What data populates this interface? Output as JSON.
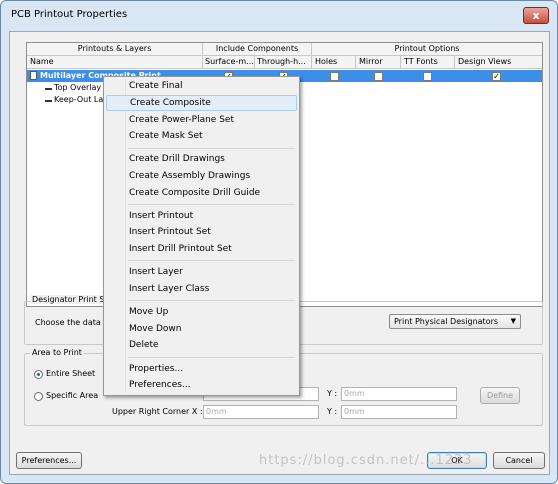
{
  "window": {
    "title": "PCB Printout Properties",
    "close_label": "x"
  },
  "grid": {
    "group_headers": [
      "Printouts & Layers",
      "Include Components",
      "Printout Options"
    ],
    "columns": [
      "Name",
      "Surface-m...",
      "Through-h...",
      "Holes",
      "Mirror",
      "TT Fonts",
      "Design Views"
    ],
    "rows": [
      {
        "name": "Multilayer Composite Print",
        "checks": [
          true,
          true,
          false,
          false,
          false,
          true
        ]
      },
      {
        "name": "Top Overlay"
      },
      {
        "name": "Keep-Out Layer"
      }
    ]
  },
  "designator": {
    "legend": "Designator Print Settings",
    "prompt": "Choose the data to print in component designators",
    "select_value": "Print Physical Designators"
  },
  "area": {
    "legend": "Area to Print",
    "entire_sheet": "Entire Sheet",
    "specific_area": "Specific Area",
    "ll_x_value": "0mm",
    "ll_y_value": "0mm",
    "upper_right_label": "Upper Right Corner X :",
    "y_label": "Y :",
    "ur_x_value": "0mm",
    "ur_y_value": "0mm",
    "define_label": "Define"
  },
  "footer": {
    "preferences": "Preferences...",
    "ok": "OK",
    "cancel": "Cancel"
  },
  "context_menu": {
    "items": [
      "Create Final",
      "Create Composite",
      "Create Power-Plane Set",
      "Create Mask Set",
      "Create Drill Drawings",
      "Create Assembly Drawings",
      "Create Composite Drill Guide",
      "Insert Printout",
      "Insert Printout Set",
      "Insert Drill Printout Set",
      "Insert Layer",
      "Insert Layer Class",
      "Move Up",
      "Move Down",
      "Delete",
      "Properties...",
      "Preferences..."
    ],
    "highlighted": "Create Composite"
  },
  "watermark": "https://blog.csdn.net/...1233"
}
